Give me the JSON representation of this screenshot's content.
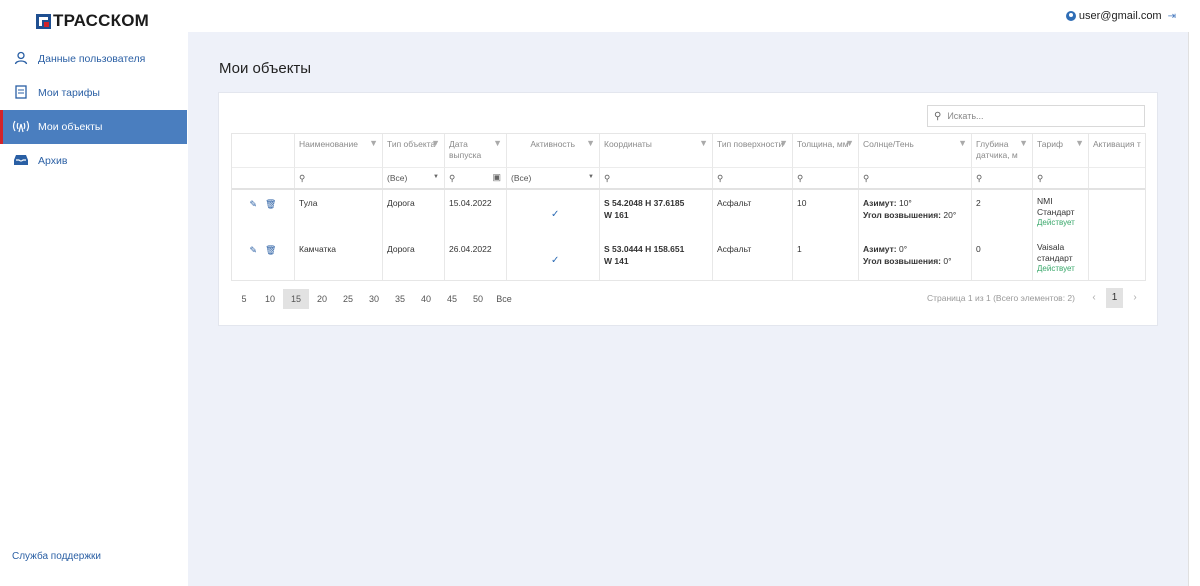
{
  "header": {
    "brand": "ТРАССКОМ",
    "user_email": "user@gmail.com",
    "user_icon": "user-circle-icon",
    "logout_icon": "logout-icon"
  },
  "sidebar": {
    "items": [
      {
        "label": "Данные пользователя",
        "icon": "user-icon"
      },
      {
        "label": "Мои тарифы",
        "icon": "document-icon"
      },
      {
        "label": "Мои объекты",
        "icon": "antenna-icon"
      },
      {
        "label": "Архив",
        "icon": "inbox-icon"
      }
    ],
    "support": "Служба поддержки",
    "active_color": "#4a7ebf",
    "accent_color": "#d2232a"
  },
  "main": {
    "title": "Мои объекты",
    "search_placeholder": "Искать..."
  },
  "table": {
    "columns": [
      {
        "label": ""
      },
      {
        "label": "Наименование"
      },
      {
        "label": "Тип объекта"
      },
      {
        "label": "Дата выпуска"
      },
      {
        "label": "Активность"
      },
      {
        "label": "Координаты"
      },
      {
        "label": "Тип поверхности"
      },
      {
        "label": "Толщина, мм"
      },
      {
        "label": "Солнце/Тень"
      },
      {
        "label": "Глубина датчика, м"
      },
      {
        "label": "Тариф"
      },
      {
        "label": "Активация т"
      }
    ],
    "filters": {
      "type_select": "(Все)",
      "activity_select": "(Все)"
    },
    "rows": [
      {
        "name": "Тула",
        "type": "Дорога",
        "date": "15.04.2022",
        "coords_line1": "S 54.2048 H 37.6185",
        "coords_line2": "W 161",
        "surface": "Асфальт",
        "thickness": "10",
        "azimuth_label": "Азимут:",
        "azimuth": "10°",
        "elevation_label": "Угол возвышения:",
        "elevation": "20°",
        "depth": "2",
        "tariff_line1": "NMI",
        "tariff_line2": "Стандарт",
        "tariff_status": "Действует"
      },
      {
        "name": "Камчатка",
        "type": "Дорога",
        "date": "26.04.2022",
        "coords_line1": "S 53.0444 H 158.651",
        "coords_line2": "W 141",
        "surface": "Асфальт",
        "thickness": "1",
        "azimuth_label": "Азимут:",
        "azimuth": "0°",
        "elevation_label": "Угол возвышения:",
        "elevation": "0°",
        "depth": "0",
        "tariff_line1": "Vaisala",
        "tariff_line2": "стандарт",
        "tariff_status": "Действует"
      }
    ]
  },
  "pager": {
    "sizes": [
      "5",
      "10",
      "15",
      "20",
      "25",
      "30",
      "35",
      "40",
      "45",
      "50",
      "Все"
    ],
    "selected_size": "15",
    "info": "Страница 1 из 1 (Всего элементов: 2)",
    "current_page": "1"
  }
}
